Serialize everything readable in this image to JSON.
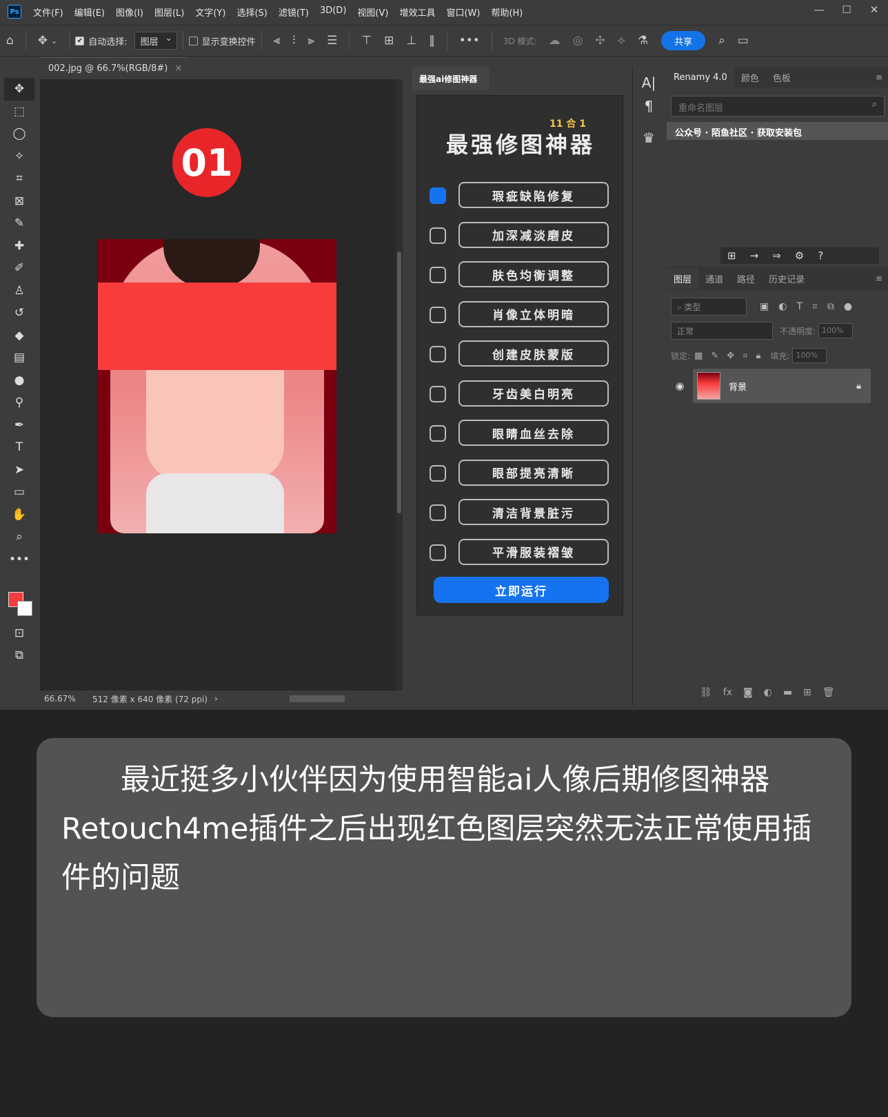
{
  "app": {
    "logo": "Ps"
  },
  "menu": [
    "文件(F)",
    "编辑(E)",
    "图像(I)",
    "图层(L)",
    "文字(Y)",
    "选择(S)",
    "滤镜(T)",
    "3D(D)",
    "视图(V)",
    "增效工具",
    "窗口(W)",
    "帮助(H)"
  ],
  "window_controls": {
    "minimize": "—",
    "maximize": "☐",
    "close": "✕"
  },
  "options": {
    "auto_select_label": "自动选择:",
    "auto_select_value": "图层",
    "show_transform_label": "显示变换控件",
    "mode_3d_label": "3D 模式:",
    "share_label": "共享"
  },
  "document": {
    "tab_title": "002.jpg @ 66.7%(RGB/8#)",
    "badge": "01",
    "zoom": "66.67%",
    "size_info": "512 像素 x 640 像素 (72 ppi)"
  },
  "plugin": {
    "tab_label": "最强ai修图神器",
    "subtitle": "11 合 1",
    "title": "最强修图神器",
    "features": [
      {
        "label": "瑕疵缺陷修复",
        "checked": true
      },
      {
        "label": "加深减淡磨皮",
        "checked": false
      },
      {
        "label": "肤色均衡调整",
        "checked": false
      },
      {
        "label": "肖像立体明暗",
        "checked": false
      },
      {
        "label": "创建皮肤蒙版",
        "checked": false
      },
      {
        "label": "牙齿美白明亮",
        "checked": false
      },
      {
        "label": "眼睛血丝去除",
        "checked": false
      },
      {
        "label": "眼部提亮清晰",
        "checked": false
      },
      {
        "label": "清洁背景脏污",
        "checked": false
      },
      {
        "label": "平滑服装褶皱",
        "checked": false
      }
    ],
    "run_label": "立即运行"
  },
  "right_panel": {
    "tabs": [
      "Renamy 4.0",
      "颜色",
      "色板"
    ],
    "rename_placeholder": "重命名图层",
    "info_bar": "公众号 · 陌鱼社区 · 获取安装包",
    "layers_tabs": [
      "图层",
      "通道",
      "路径",
      "历史记录"
    ],
    "filter_label": "类型",
    "blend_mode": "正常",
    "opacity_label": "不透明度:",
    "opacity_value": "100%",
    "lock_label": "锁定:",
    "fill_label": "填充:",
    "fill_value": "100%",
    "layer_name": "背景"
  },
  "caption": {
    "text": "最近挺多小伙伴因为使用智能ai人像后期修图神器Retouch4me插件之后出现红色图层突然无法正常使用插件的问题"
  },
  "colors": {
    "accent": "#1673f0",
    "badge": "#e8262a",
    "foreground_swatch": "#f23d3d",
    "cover_bar": "#f83c3c"
  }
}
